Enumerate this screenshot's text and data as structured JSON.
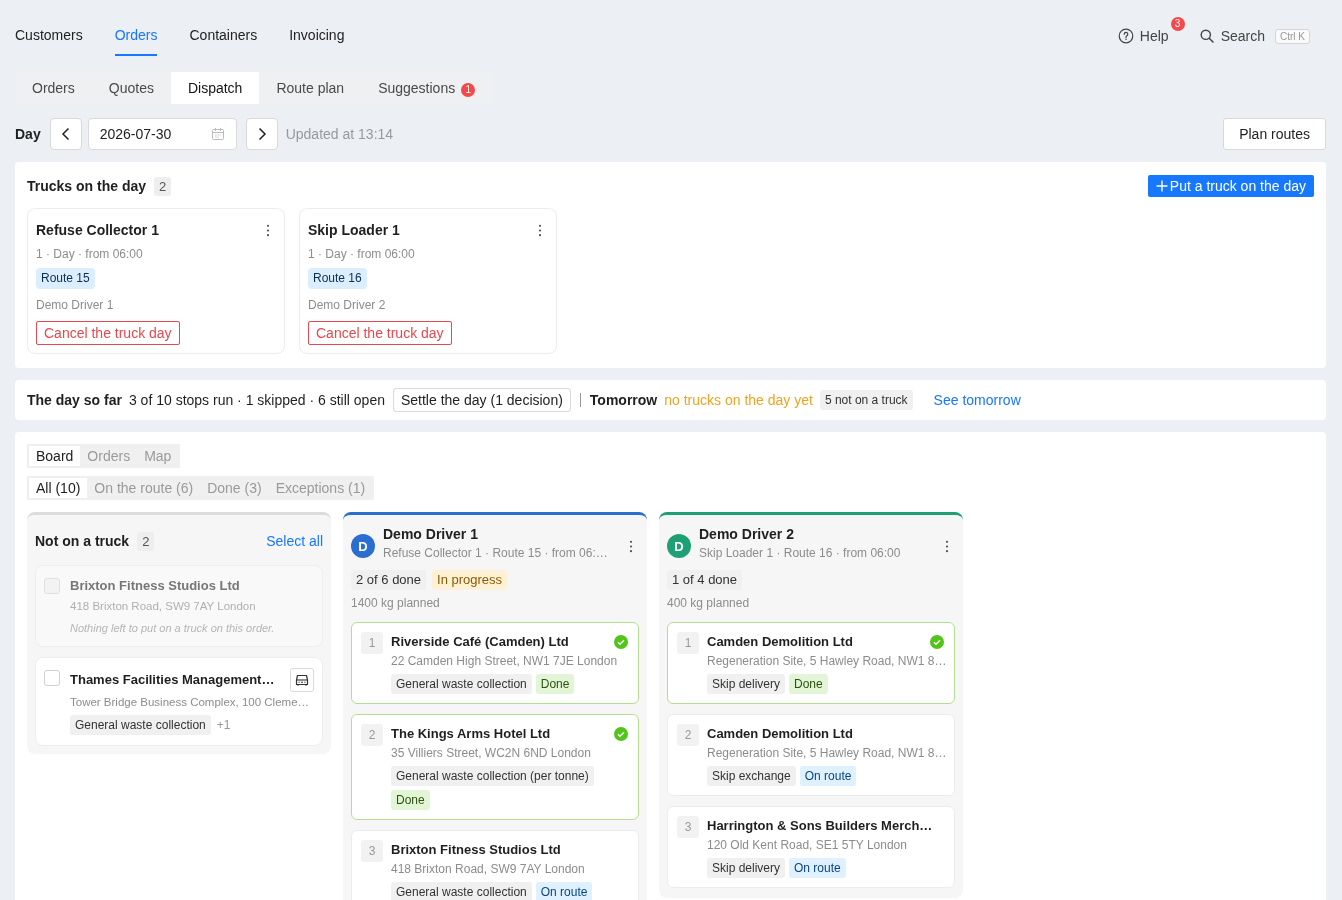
{
  "top_nav": {
    "tabs": [
      {
        "label": "Customers",
        "selected": false
      },
      {
        "label": "Orders",
        "selected": true
      },
      {
        "label": "Containers",
        "selected": false
      },
      {
        "label": "Invoicing",
        "selected": false
      }
    ],
    "help": {
      "label": "Help",
      "badge": "3"
    },
    "search": {
      "label": "Search",
      "shortcut": "Ctrl K"
    }
  },
  "sub_tabs": [
    {
      "label": "Orders",
      "selected": false
    },
    {
      "label": "Quotes",
      "selected": false
    },
    {
      "label": "Dispatch",
      "selected": true
    },
    {
      "label": "Route plan",
      "selected": false
    },
    {
      "label": "Suggestions",
      "selected": false,
      "badge": "1"
    }
  ],
  "day_bar": {
    "label": "Day",
    "date": "2026-07-30",
    "updated": "Updated at 13:14",
    "plan_button": "Plan routes"
  },
  "trucks": {
    "title": "Trucks on the day",
    "count": "2",
    "add_button": "Put a truck on the day",
    "cards": [
      {
        "name": "Refuse Collector 1",
        "schedule": "1 · Day · from 06:00",
        "route": "Route 15",
        "driver": "Demo Driver 1",
        "cancel_button": "Cancel the truck day"
      },
      {
        "name": "Skip Loader 1",
        "schedule": "1 · Day · from 06:00",
        "route": "Route 16",
        "driver": "Demo Driver 2",
        "cancel_button": "Cancel the truck day"
      }
    ]
  },
  "day_summary": {
    "title": "The day so far",
    "stats": "3 of 10 stops run · 1 skipped · 6 still open",
    "settle_button": "Settle the day (1 decision)",
    "tomorrow_label": "Tomorrow",
    "tomorrow_status": "no trucks on the day yet",
    "unassigned_tag": "5 not on a truck",
    "link": "See tomorrow"
  },
  "board": {
    "views": [
      {
        "label": "Board",
        "selected": true
      },
      {
        "label": "Orders",
        "selected": false
      },
      {
        "label": "Map",
        "selected": false
      }
    ],
    "filters": [
      {
        "label": "All (10)",
        "selected": true
      },
      {
        "label": "On the route (6)",
        "selected": false
      },
      {
        "label": "Done (3)",
        "selected": false
      },
      {
        "label": "Exceptions (1)",
        "selected": false
      }
    ],
    "unassigned": {
      "title": "Not on a truck",
      "count": "2",
      "select_all": "Select all",
      "orders": [
        {
          "name": "Brixton Fitness Studios Ltd",
          "address": "418 Brixton Road, SW9 7AY London",
          "note": "Nothing left to put on a truck on this order.",
          "disabled": true,
          "checked": false
        },
        {
          "name": "Thames Facilities Management…",
          "address": "Tower Bridge Business Complex, 100 Cleme…",
          "tags": [
            "General waste collection"
          ],
          "more": "+1",
          "disabled": false,
          "checked": false
        }
      ]
    },
    "routes": [
      {
        "driver": "Demo Driver 1",
        "initial": "D",
        "color": "#2a6fd0",
        "details": "Refuse Collector 1 · Route 15 · from 06:…",
        "progress": "2 of 6 done",
        "status": {
          "label": "In progress",
          "kind": "in_progress"
        },
        "weight": "1400 kg planned",
        "stops": [
          {
            "number": "1",
            "name": "Riverside Café (Camden) Ltd",
            "address": "22 Camden High Street, NW1 7JE London",
            "service": "General waste collection",
            "status": {
              "label": "Done",
              "kind": "done"
            }
          },
          {
            "number": "2",
            "name": "The Kings Arms Hotel Ltd",
            "address": "35 Villiers Street, WC2N 6ND London",
            "service": "General waste collection (per tonne)",
            "status": {
              "label": "Done",
              "kind": "done"
            }
          },
          {
            "number": "3",
            "name": "Brixton Fitness Studios Ltd",
            "address": "418 Brixton Road, SW9 7AY London",
            "service": "General waste collection",
            "status": {
              "label": "On route",
              "kind": "on_route"
            }
          }
        ]
      },
      {
        "driver": "Demo Driver 2",
        "initial": "D",
        "color": "#1fa074",
        "details": "Skip Loader 1 · Route 16 · from 06:00",
        "progress": "1 of 4 done",
        "weight": "400 kg planned",
        "stops": [
          {
            "number": "1",
            "name": "Camden Demolition Ltd",
            "address": "Regeneration Site, 5 Hawley Road, NW1 8…",
            "service": "Skip delivery",
            "status": {
              "label": "Done",
              "kind": "done"
            }
          },
          {
            "number": "2",
            "name": "Camden Demolition Ltd",
            "address": "Regeneration Site, 5 Hawley Road, NW1 8…",
            "service": "Skip exchange",
            "status": {
              "label": "On route",
              "kind": "on_route"
            }
          },
          {
            "number": "3",
            "name": "Harrington & Sons Builders Merch…",
            "address": "120 Old Kent Road, SE1 5TY London",
            "service": "Skip delivery",
            "status": {
              "label": "On route",
              "kind": "on_route"
            }
          }
        ]
      }
    ]
  }
}
